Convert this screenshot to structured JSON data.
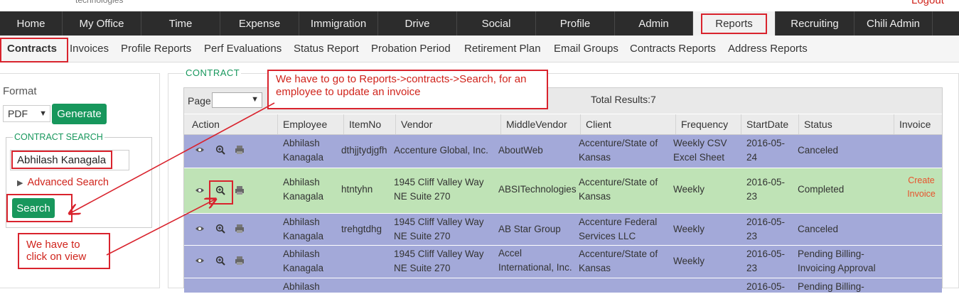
{
  "header": {
    "brand": "technologies",
    "logout": "Logout"
  },
  "nav": [
    {
      "label": "Home"
    },
    {
      "label": "My Office"
    },
    {
      "label": "Time"
    },
    {
      "label": "Expense"
    },
    {
      "label": "Immigration"
    },
    {
      "label": "Drive"
    },
    {
      "label": "Social"
    },
    {
      "label": "Profile"
    },
    {
      "label": "Admin"
    },
    {
      "label": "Reports"
    },
    {
      "label": "Recruiting"
    },
    {
      "label": "Chili Admin"
    }
  ],
  "subnav": [
    {
      "label": "Contracts"
    },
    {
      "label": "Invoices"
    },
    {
      "label": "Profile Reports"
    },
    {
      "label": "Perf Evaluations"
    },
    {
      "label": "Status Report"
    },
    {
      "label": "Probation Period"
    },
    {
      "label": "Retirement Plan"
    },
    {
      "label": "Email Groups"
    },
    {
      "label": "Contracts Reports"
    },
    {
      "label": "Address Reports"
    }
  ],
  "left": {
    "format_label": "Format",
    "format_value": "PDF",
    "generate": "Generate",
    "legend": "CONTRACT SEARCH",
    "search_value": "Abhilash Kanagala",
    "advanced": "Advanced Search",
    "search_button": "Search"
  },
  "main": {
    "title": "CONTRACT",
    "page_label": "Page:",
    "total": "Total Results:7",
    "columns": [
      "Action",
      "Employee",
      "ItemNo",
      "Vendor",
      "MiddleVendor",
      "Client",
      "Frequency",
      "StartDate",
      "Status",
      "Invoice"
    ],
    "rows": [
      {
        "employee": [
          "Abhilash",
          "Kanagala"
        ],
        "itemno": "dthjjtydjgfh",
        "vendor": [
          "Accenture Global, Inc."
        ],
        "middle": "AboutWeb",
        "client": [
          "Accenture/State of",
          "Kansas"
        ],
        "frequency": [
          "Weekly CSV",
          "Excel Sheet"
        ],
        "start": [
          "2016-05-",
          "24"
        ],
        "status": [
          "Canceled"
        ],
        "invoice": []
      },
      {
        "employee": [
          "Abhilash",
          "Kanagala"
        ],
        "itemno": "htntyhn",
        "vendor": [
          "1945 Cliff Valley Way",
          "NE Suite 270"
        ],
        "middle": "ABSITechnologies",
        "client": [
          "Accenture/State of",
          "Kansas"
        ],
        "frequency": [
          "Weekly"
        ],
        "start": [
          "2016-05-",
          "23"
        ],
        "status": [
          "Completed"
        ],
        "invoice": [
          "Create",
          "Invoice"
        ]
      },
      {
        "employee": [
          "Abhilash",
          "Kanagala"
        ],
        "itemno": "trehgtdhg",
        "vendor": [
          "1945 Cliff Valley Way",
          "NE Suite 270"
        ],
        "middle": "AB Star Group",
        "client": [
          "Accenture Federal",
          "Services LLC"
        ],
        "frequency": [
          "Weekly"
        ],
        "start": [
          "2016-05-",
          "23"
        ],
        "status": [
          "Canceled"
        ],
        "invoice": []
      },
      {
        "employee": [
          "Abhilash",
          "Kanagala"
        ],
        "itemno": "",
        "vendor": [
          "1945 Cliff Valley Way",
          "NE Suite 270"
        ],
        "middle": "Accel International, Inc.",
        "client": [
          "Accenture/State of",
          "Kansas"
        ],
        "frequency": [
          "Weekly"
        ],
        "start": [
          "2016-05-",
          "23"
        ],
        "status": [
          "Pending Billing-",
          "Invoicing Approval"
        ],
        "invoice": []
      },
      {
        "employee": [
          "Abhilash",
          ""
        ],
        "itemno": "",
        "vendor": [
          "",
          ""
        ],
        "middle": "",
        "client": [
          "",
          ""
        ],
        "frequency": [
          ""
        ],
        "start": [
          "2016-05-",
          ""
        ],
        "status": [
          "Pending Billing-",
          ""
        ],
        "invoice": []
      }
    ]
  },
  "annotations": {
    "callout_top": "We have to go to Reports->contracts->Search, for an employee to update an invoice",
    "callout_bottom": "We have to click on view"
  },
  "colors": {
    "row_purple": "#a3a9d9",
    "row_green": "#bfe3b6",
    "accent_green": "#17975c",
    "annotation_red": "#d9232d",
    "nav_dark": "#2c2c2c"
  }
}
